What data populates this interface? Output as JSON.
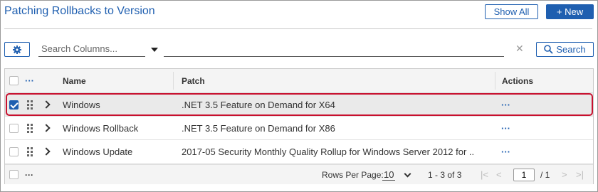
{
  "header": {
    "title": "Patching Rollbacks to Version",
    "show_all_label": "Show All",
    "new_label": "+ New"
  },
  "toolbar": {
    "search_columns_placeholder": "Search Columns...",
    "search_value": "",
    "clear_label": "✕",
    "search_label": "Search"
  },
  "grid": {
    "columns": {
      "name": "Name",
      "patch": "Patch",
      "actions": "Actions"
    },
    "rows": [
      {
        "name": "Windows",
        "patch": ".NET 3.5 Feature on Demand for X64",
        "checked": true
      },
      {
        "name": "Windows Rollback",
        "patch": ".NET 3.5 Feature on Demand for X86",
        "checked": false
      },
      {
        "name": "Windows Update",
        "patch": "2017-05 Security Monthly Quality Rollup for Windows Server 2012 for ..",
        "checked": false
      }
    ],
    "actions_menu": "···"
  },
  "footer": {
    "rows_per_page_label": "Rows Per Page:",
    "rows_per_page_value": "10",
    "range": "1 - 3 of 3",
    "page_value": "1",
    "page_total": "/ 1"
  },
  "colors": {
    "accent": "#1f5fb0",
    "selection_outline": "#c8102e"
  }
}
